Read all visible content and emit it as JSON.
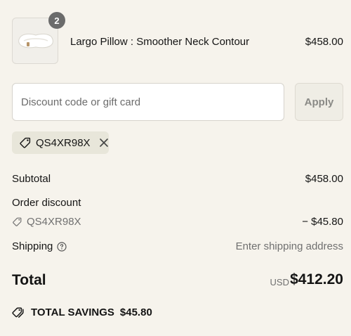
{
  "line_item": {
    "quantity": "2",
    "name": "Largo Pillow : Smoother Neck Contour",
    "price": "$458.00"
  },
  "discount": {
    "placeholder": "Discount code or gift card",
    "apply_label": "Apply",
    "applied_code": "QS4XR98X"
  },
  "summary": {
    "subtotal_label": "Subtotal",
    "subtotal_value": "$458.00",
    "order_discount_label": "Order discount",
    "order_discount_code": "QS4XR98X",
    "order_discount_value": "− $45.80",
    "shipping_label": "Shipping",
    "shipping_value": "Enter shipping address",
    "total_label": "Total",
    "total_currency": "USD",
    "total_value": "$412.20",
    "savings_label": "TOTAL SAVINGS",
    "savings_value": "$45.80"
  },
  "icons": {
    "tag": "tag-icon",
    "remove": "close-icon",
    "info": "info-icon",
    "savings": "tags-icon"
  }
}
